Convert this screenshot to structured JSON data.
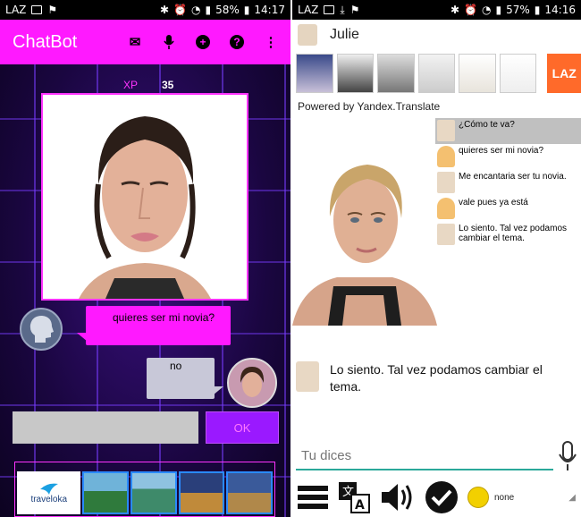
{
  "left": {
    "status": {
      "left_icons": "LAZ",
      "battery": "58%",
      "time": "14:17"
    },
    "app": {
      "title": "ChatBot"
    },
    "xp": {
      "label": "XP",
      "value": "35"
    },
    "chat": {
      "bot_message": "quieres ser mi novia?",
      "user_message": "no"
    },
    "input": {
      "value": "",
      "ok_label": "OK"
    },
    "ad": {
      "logo_text": "traveloka"
    }
  },
  "right": {
    "status": {
      "left_icons": "LAZ",
      "battery": "57%",
      "time": "14:16"
    },
    "header": {
      "name": "Julie"
    },
    "ads": {
      "laz_label": "LAZ"
    },
    "powered_by": "Powered by Yandex.Translate",
    "log": [
      {
        "text": "¿Cómo te va?",
        "who": "bot",
        "selected": true
      },
      {
        "text": "quieres ser mi novia?",
        "who": "user",
        "selected": false
      },
      {
        "text": "Me encantaria ser tu novia.",
        "who": "bot",
        "selected": false
      },
      {
        "text": "vale pues ya está",
        "who": "user",
        "selected": false
      },
      {
        "text": "Lo siento. Tal vez podamos cambiar el tema.",
        "who": "bot",
        "selected": false
      }
    ],
    "reply": "Lo siento. Tal vez podamos cambiar el tema.",
    "input": {
      "placeholder": "Tu dices"
    },
    "toolbar": {
      "emotion": "none"
    }
  },
  "colors": {
    "magenta": "#ff19ff",
    "purple": "#9a19ff",
    "teal": "#2aa89a"
  }
}
